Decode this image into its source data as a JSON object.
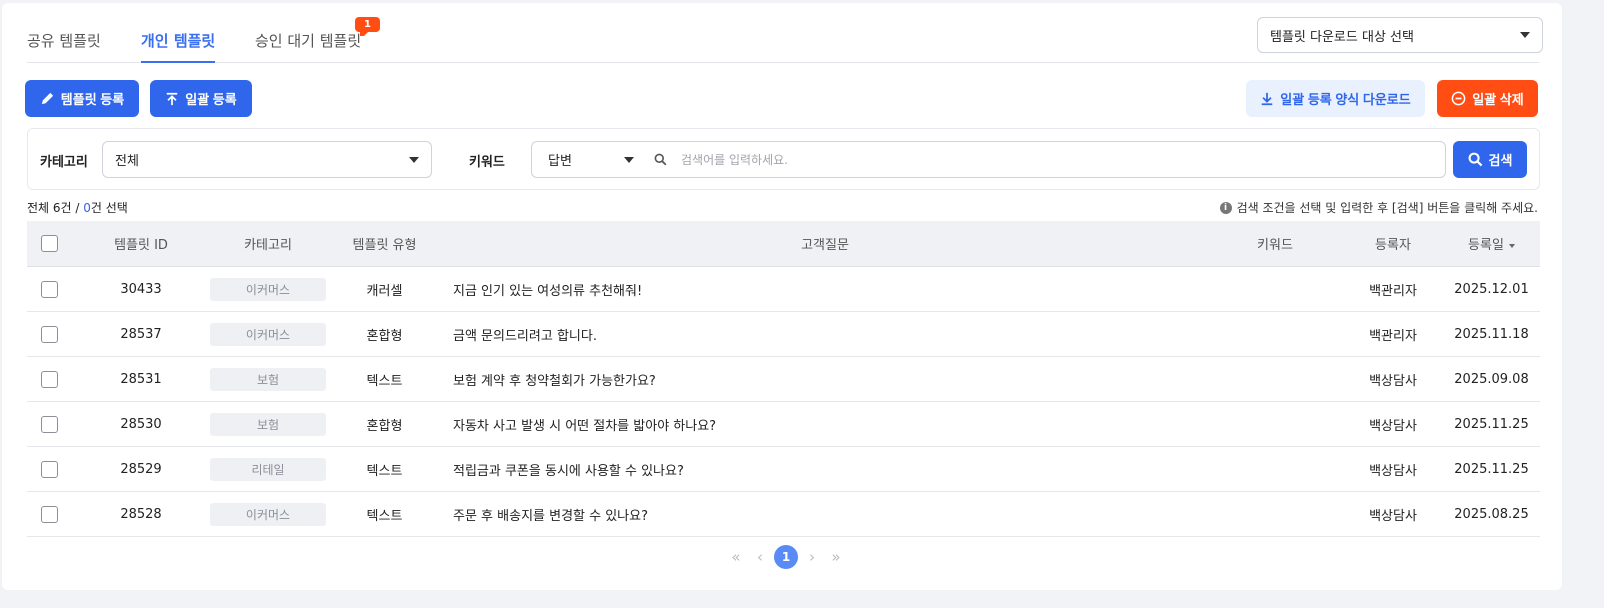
{
  "tabs": [
    {
      "label": "공유 템플릿"
    },
    {
      "label": "개인 템플릿"
    },
    {
      "label": "승인 대기 템플릿",
      "badge": "1"
    }
  ],
  "download_target_select": {
    "value": "템플릿 다운로드 대상 선택"
  },
  "toolbar": {
    "register_label": "템플릿 등록",
    "bulk_register_label": "일괄 등록",
    "bulk_form_download_label": "일괄 등록 양식 다운로드",
    "bulk_delete_label": "일괄 삭제"
  },
  "filter": {
    "category_label": "카테고리",
    "category_value": "전체",
    "keyword_label": "키워드",
    "keyword_type_value": "답변",
    "keyword_placeholder": "검색어를 입력하세요.",
    "search_label": "검색"
  },
  "summary": {
    "prefix": "전체 6건 / ",
    "selected": "0",
    "suffix": "건 선택"
  },
  "hint": "검색 조건을 선택 및 입력한 후 [검색] 버튼을 클릭해 주세요.",
  "table": {
    "headers": {
      "id": "템플릿 ID",
      "category": "카테고리",
      "type": "템플릿 유형",
      "question": "고객질문",
      "keyword": "키워드",
      "registrant": "등록자",
      "date": "등록일"
    },
    "rows": [
      {
        "id": "30433",
        "category": "이커머스",
        "type": "캐러셀",
        "question": "지금 인기 있는 여성의류 추천해줘!",
        "keyword": "",
        "registrant": "백관리자",
        "date": "2025.12.01"
      },
      {
        "id": "28537",
        "category": "이커머스",
        "type": "혼합형",
        "question": "금액 문의드리려고 합니다.",
        "keyword": "",
        "registrant": "백관리자",
        "date": "2025.11.18"
      },
      {
        "id": "28531",
        "category": "보험",
        "type": "텍스트",
        "question": "보험 계약 후 청약철회가 가능한가요?",
        "keyword": "",
        "registrant": "백상담사",
        "date": "2025.09.08"
      },
      {
        "id": "28530",
        "category": "보험",
        "type": "혼합형",
        "question": "자동차 사고 발생 시 어떤 절차를 밟아야 하나요?",
        "keyword": "",
        "registrant": "백상담사",
        "date": "2025.11.25"
      },
      {
        "id": "28529",
        "category": "리테일",
        "type": "텍스트",
        "question": "적립금과 쿠폰을 동시에 사용할 수 있나요?",
        "keyword": "",
        "registrant": "백상담사",
        "date": "2025.11.25"
      },
      {
        "id": "28528",
        "category": "이커머스",
        "type": "텍스트",
        "question": "주문 후 배송지를 변경할 수 있나요?",
        "keyword": "",
        "registrant": "백상담사",
        "date": "2025.08.25"
      }
    ]
  },
  "pagination": {
    "current": "1",
    "first": "«",
    "prev": "‹",
    "next": "›",
    "last": "»"
  },
  "colors": {
    "primary": "#2f66ec",
    "danger": "#ff4d14",
    "light": "#e9f0fe"
  }
}
